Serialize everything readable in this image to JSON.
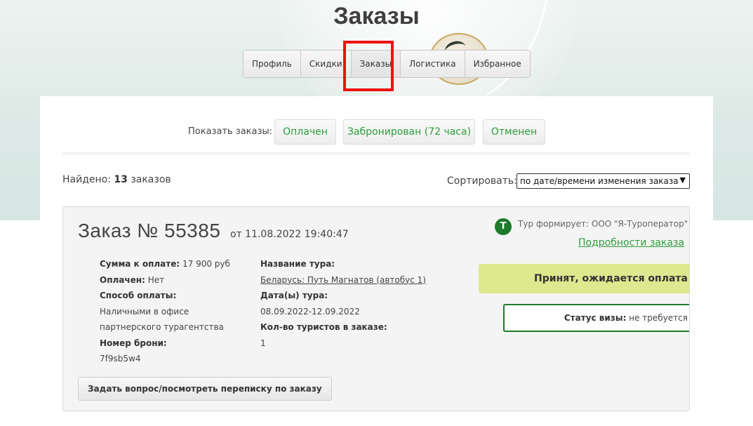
{
  "page": {
    "title": "Заказы"
  },
  "tabs": [
    {
      "label": "Профиль"
    },
    {
      "label": "Скидки"
    },
    {
      "label": "Заказы"
    },
    {
      "label": "Логистика"
    },
    {
      "label": "Избранное"
    }
  ],
  "filters": {
    "label": "Показать заказы:",
    "buttons": [
      {
        "label": "Оплачен"
      },
      {
        "label": "Забронирован (72 часа)"
      },
      {
        "label": "Отменен"
      }
    ]
  },
  "results": {
    "found_label": "Найдено:",
    "found_count": "13",
    "found_suffix": "заказов"
  },
  "sort": {
    "label": "Сортировать:",
    "selected": "по дате/времени изменения заказа"
  },
  "order": {
    "title": "Заказ № 55385",
    "date": "от 11.08.2022 19:40:47",
    "operator_badge": "Т",
    "operator_text": "Тур формирует: ООО \"Я-Туроператор\"",
    "details_link": "Подробности заказа",
    "left": {
      "sum_label": "Сумма к оплате:",
      "sum_value": "17 900 руб",
      "paid_label": "Оплачен:",
      "paid_value": "Нет",
      "method_label": "Способ оплаты:",
      "method_value_1": "Наличными в офисе",
      "method_value_2": "партнерского турагентства",
      "booking_label": "Номер брони:",
      "booking_value": "7f9sb5w4"
    },
    "middle": {
      "tour_name_label": "Название тура:",
      "tour_name_value": "Беларусь: Путь Магнатов (автобус 1)",
      "dates_label": "Дата(ы) тура:",
      "dates_value": "08.09.2022-12.09.2022",
      "tourists_label": "Кол-во туристов в заказе:",
      "tourists_value": "1"
    },
    "status": "Принят, ожидается оплата",
    "visa_label": "Статус визы:",
    "visa_value": "не требуется",
    "ask_button": "Задать вопрос/посмотреть переписку по заказу"
  },
  "colors": {
    "accent_green": "#2f9c3a",
    "badge_green": "#1f7a2c",
    "status_bar": "#dde88f",
    "highlight_red": "#ee1111"
  }
}
